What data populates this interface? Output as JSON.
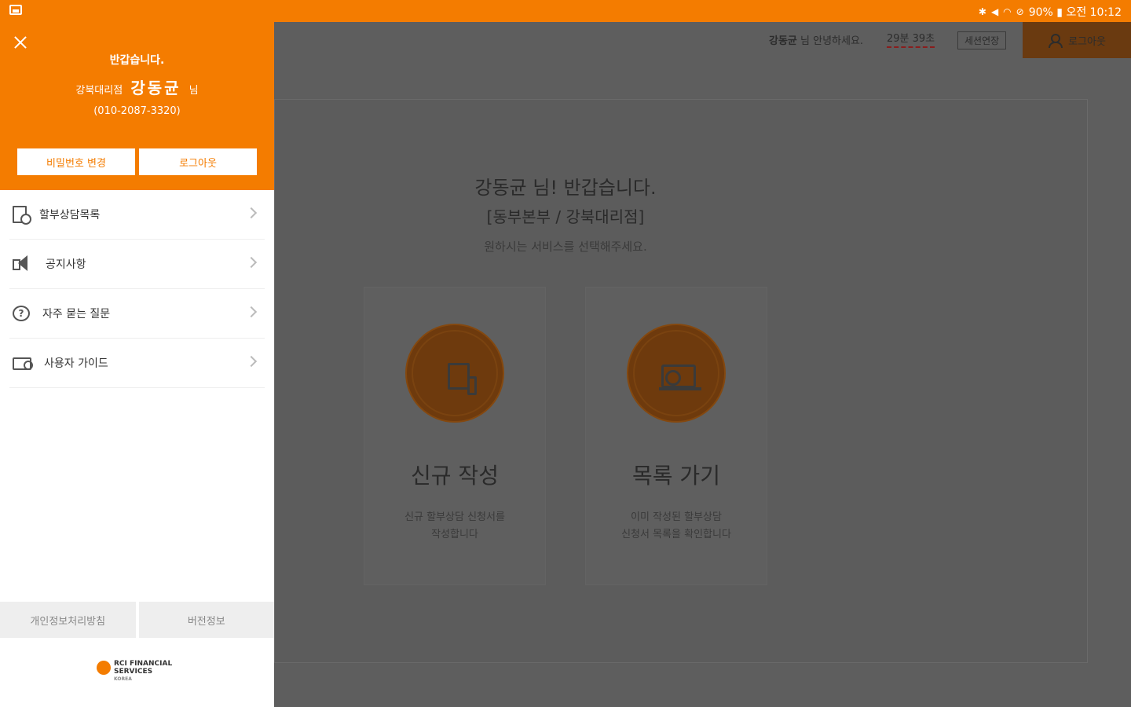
{
  "statusbar": {
    "right_text": "90% ▮ 오전 10:12",
    "icons": [
      "bluetooth-icon",
      "mute-icon",
      "wifi-icon",
      "alarm-icon"
    ]
  },
  "header": {
    "greeting_name": "강동균",
    "greeting_suffix": "님 안녕하세요.",
    "timer": "29분 39초",
    "extend_label": "세션연장",
    "logout_label": "로그아웃"
  },
  "main": {
    "welcome_line1": "강동균 님! 반갑습니다.",
    "welcome_line2": "[동부본부 / 강북대리점]",
    "welcome_line3": "원하시는 서비스를 선택해주세요.",
    "cards": [
      {
        "title": "신규 작성",
        "desc": "신규 할부상담 신청서를\n작성합니다",
        "icon": "document-icon"
      },
      {
        "title": "목록 가기",
        "desc": "이미 작성된 할부상담\n신청서 목록을 확인합니다",
        "icon": "list-book-icon"
      }
    ]
  },
  "drawer": {
    "hello": "반갑습니다.",
    "branch": "강북대리점",
    "user_name": "강동균",
    "honorific": "님",
    "phone": "(010-2087-3320)",
    "change_pw_label": "비밀번호 변경",
    "logout_label": "로그아웃",
    "menu": [
      {
        "label": "할부상담목록",
        "icon": "consult-list-icon"
      },
      {
        "label": "공지사항",
        "icon": "megaphone-icon"
      },
      {
        "label": "자주 묻는 질문",
        "icon": "faq-icon"
      },
      {
        "label": "사용자 가이드",
        "icon": "guide-icon"
      }
    ],
    "footer_privacy": "개인정보처리방침",
    "footer_version": "버전정보",
    "logo_line1": "RCI FINANCIAL",
    "logo_line2": "SERVICES",
    "logo_line3": "KOREA"
  },
  "colors": {
    "accent": "#f47c00",
    "overlay": "#5e5e5e"
  }
}
